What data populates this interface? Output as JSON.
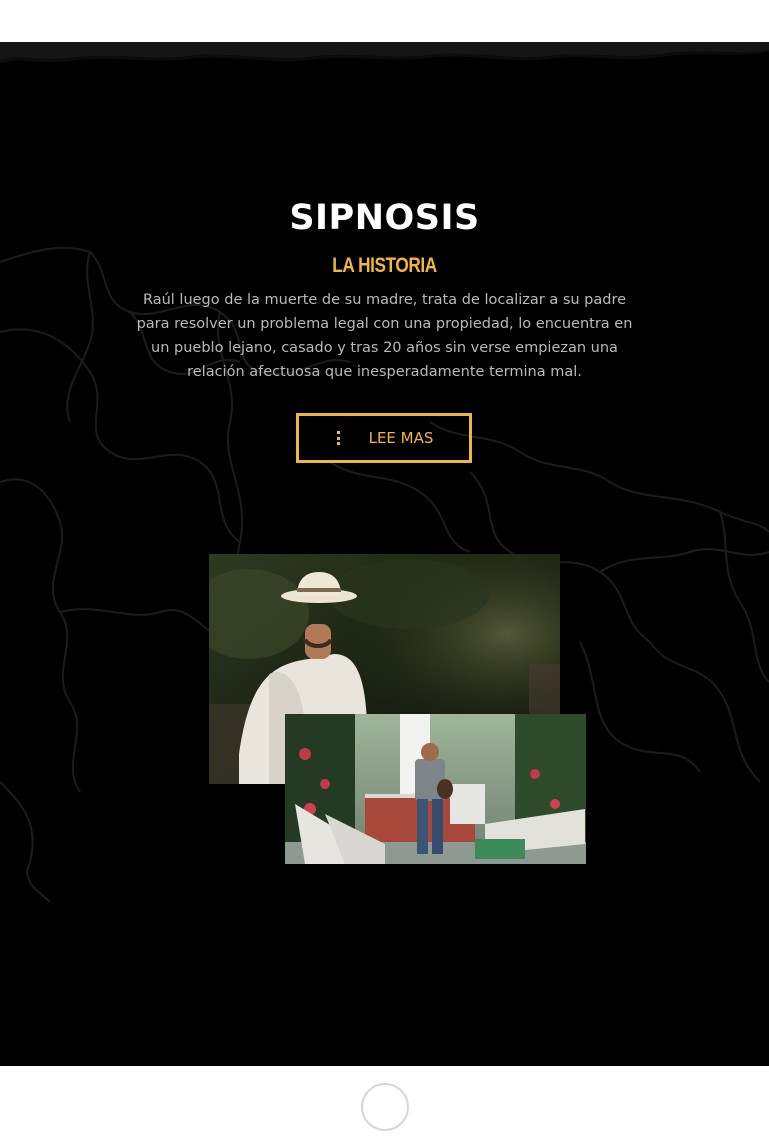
{
  "sipnosis": {
    "title": "SIPNOSIS",
    "subtitle": "LA HISTORIA",
    "body": "Raúl luego de la muerte de su madre, trata de localizar a su padre para resolver un problema legal con una propiedad, lo encuentra en un pueblo lejano, casado y tras 20 años sin verse empiezan una relación afectuosa que inesperadamente termina mal.",
    "button_label": "LEE MAS",
    "button_icon": "vertical-dots-icon"
  },
  "colors": {
    "accent": "#f2b63c",
    "background": "#000000",
    "title": "#ffffff",
    "body_text": "#b9b9b9"
  }
}
